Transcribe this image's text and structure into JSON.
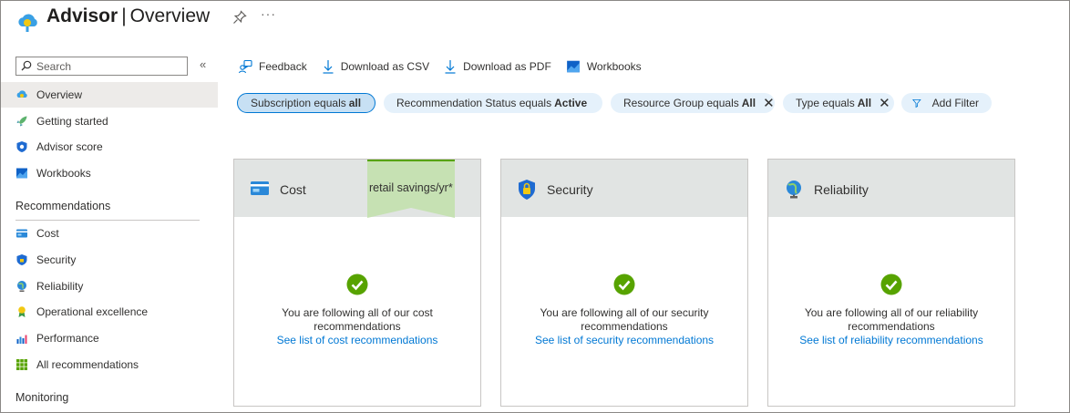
{
  "header": {
    "title": "Advisor",
    "separator": "|",
    "subtitle": "Overview",
    "more": "···"
  },
  "sidebar": {
    "search_placeholder": "Search",
    "collapse_glyph": "«",
    "top_items": [
      {
        "label": "Overview",
        "icon": "cloud-advisor-icon",
        "active": true
      },
      {
        "label": "Getting started",
        "icon": "rocket-icon"
      },
      {
        "label": "Advisor score",
        "icon": "shield-score-icon"
      },
      {
        "label": "Workbooks",
        "icon": "workbooks-icon"
      }
    ],
    "recommendations_heading": "Recommendations",
    "recommendation_items": [
      {
        "label": "Cost",
        "icon": "cost-icon"
      },
      {
        "label": "Security",
        "icon": "security-shield-icon"
      },
      {
        "label": "Reliability",
        "icon": "globe-icon"
      },
      {
        "label": "Operational excellence",
        "icon": "ribbon-icon"
      },
      {
        "label": "Performance",
        "icon": "performance-icon"
      },
      {
        "label": "All recommendations",
        "icon": "grid-icon"
      }
    ],
    "monitoring_heading": "Monitoring"
  },
  "toolbar": {
    "feedback": "Feedback",
    "download_csv": "Download as CSV",
    "download_pdf": "Download as PDF",
    "workbooks": "Workbooks"
  },
  "filters": {
    "subscription": {
      "label": "Subscription equals",
      "value": "all"
    },
    "status": {
      "label": "Recommendation Status equals",
      "value": "Active"
    },
    "resource_group": {
      "label": "Resource Group equals",
      "value": "All",
      "remove": "✕"
    },
    "type": {
      "label": "Type equals",
      "value": "All",
      "remove": "✕"
    },
    "add_filter": "Add Filter"
  },
  "cards": [
    {
      "title": "Cost",
      "savings_label": "retail savings/yr*",
      "message": "You are following all of our cost recommendations",
      "link": "See list of cost recommendations"
    },
    {
      "title": "Security",
      "message": "You are following all of our security recommendations",
      "link": "See list of security recommendations"
    },
    {
      "title": "Reliability",
      "message": "You are following all of our reliability recommendations",
      "link": "See list of reliability recommendations"
    }
  ],
  "colors": {
    "accent": "#0078d4",
    "success": "#57a300",
    "savings_banner": "#c6e1b3",
    "card_header": "#e1e4e3"
  }
}
